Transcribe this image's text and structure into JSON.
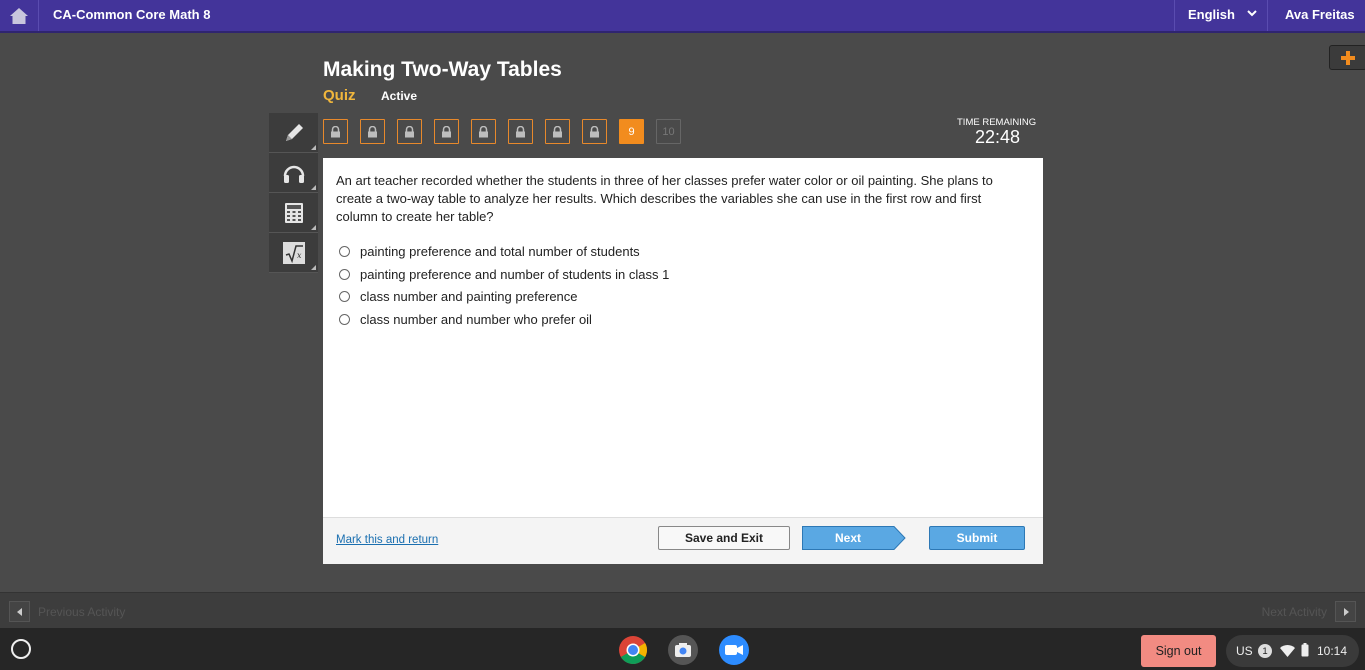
{
  "topbar": {
    "home_icon": "home-icon",
    "course_title": "CA-Common Core Math 8",
    "language": "English",
    "user_name": "Ava Freitas"
  },
  "header": {
    "title": "Making Two-Way Tables",
    "type": "Quiz",
    "status": "Active"
  },
  "tools": [
    {
      "name": "tool-pencil",
      "icon": "pencil-icon"
    },
    {
      "name": "tool-audio",
      "icon": "headphones-icon"
    },
    {
      "name": "tool-calculator",
      "icon": "calculator-icon"
    },
    {
      "name": "tool-formula",
      "icon": "formula-icon"
    }
  ],
  "question_nav": {
    "items": [
      {
        "label": "",
        "state": "locked"
      },
      {
        "label": "",
        "state": "locked"
      },
      {
        "label": "",
        "state": "locked"
      },
      {
        "label": "",
        "state": "locked"
      },
      {
        "label": "",
        "state": "locked"
      },
      {
        "label": "",
        "state": "locked"
      },
      {
        "label": "",
        "state": "locked"
      },
      {
        "label": "",
        "state": "locked"
      },
      {
        "label": "9",
        "state": "current"
      },
      {
        "label": "10",
        "state": "disabled"
      }
    ],
    "locked_icon": "lock-icon"
  },
  "timer": {
    "label": "TIME REMAINING",
    "value": "22:48"
  },
  "question": {
    "text": "An art teacher recorded whether the students in three of her classes prefer water color or oil painting. She plans to create a two-way table to analyze her results. Which describes the variables she can use in the first row and first column to create her table?",
    "choices": [
      "painting preference and total number of students",
      "painting preference and number of students in class 1",
      "class number and painting preference",
      "class number and number who prefer oil"
    ]
  },
  "footer": {
    "mark_link": "Mark this and return",
    "save_label": "Save and Exit",
    "next_label": "Next",
    "submit_label": "Submit"
  },
  "activity_nav": {
    "prev_label": "Previous Activity",
    "next_label": "Next Activity"
  },
  "shelf": {
    "apps": [
      "chrome-icon",
      "camera-icon",
      "zoom-icon"
    ],
    "signout_label": "Sign out",
    "locale": "US",
    "notification_count": "1",
    "time": "10:14"
  },
  "colors": {
    "topbar": "#43349a",
    "accent_orange": "#f28c1e",
    "primary_blue": "#5aa8e3",
    "signout": "#f28b82"
  }
}
